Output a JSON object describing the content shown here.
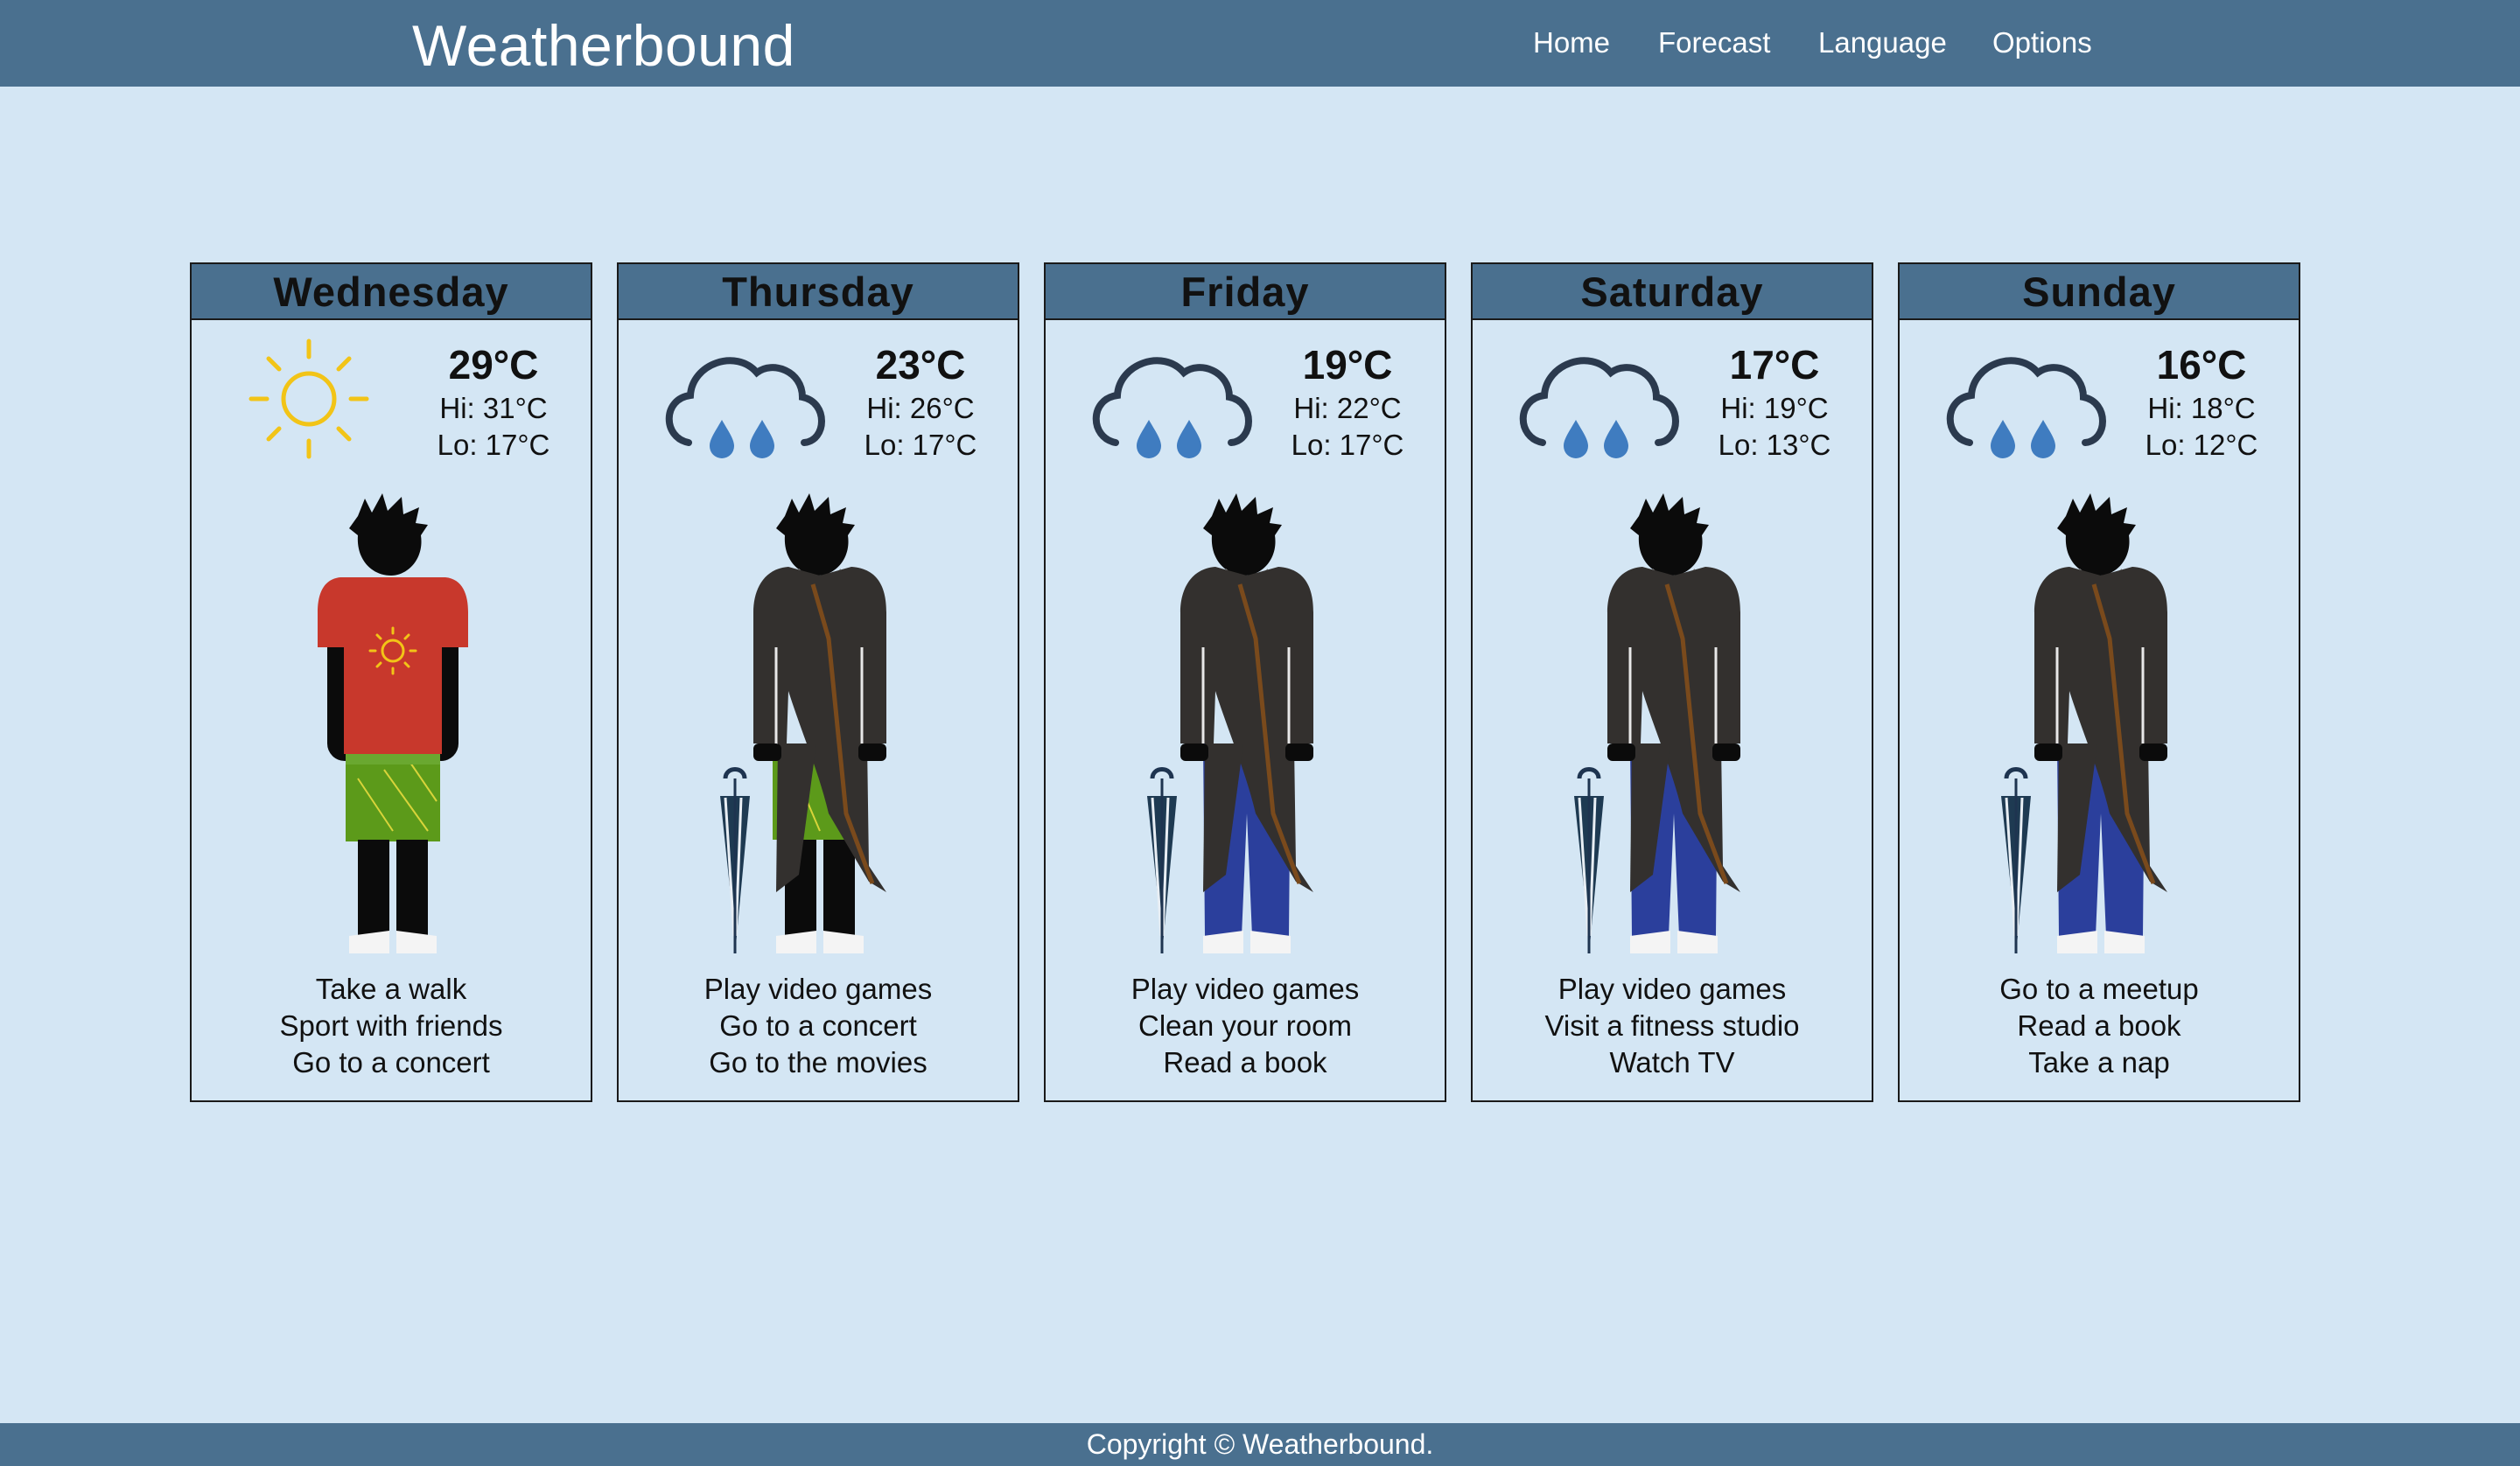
{
  "brand": "Weatherbound",
  "nav": [
    "Home",
    "Forecast",
    "Language",
    "Options"
  ],
  "days": [
    {
      "name": "Wednesday",
      "temp": "29°C",
      "hi": "Hi: 31°C",
      "lo": "Lo: 17°C",
      "icon": "sun-icon",
      "outfit": "t-shirt-shorts",
      "activities": [
        "Take a walk",
        "Sport with friends",
        "Go to a concert"
      ]
    },
    {
      "name": "Thursday",
      "temp": "23°C",
      "hi": "Hi: 26°C",
      "lo": "Lo: 17°C",
      "icon": "rain-cloud-icon",
      "outfit": "coat-shorts-umbrella",
      "activities": [
        "Play video games",
        "Go to a concert",
        "Go to the movies"
      ]
    },
    {
      "name": "Friday",
      "temp": "19°C",
      "hi": "Hi: 22°C",
      "lo": "Lo: 17°C",
      "icon": "rain-cloud-icon",
      "outfit": "coat-jeans-umbrella",
      "activities": [
        "Play video games",
        "Clean your room",
        "Read a book"
      ]
    },
    {
      "name": "Saturday",
      "temp": "17°C",
      "hi": "Hi: 19°C",
      "lo": "Lo: 13°C",
      "icon": "rain-cloud-icon",
      "outfit": "coat-jeans-umbrella",
      "activities": [
        "Play video games",
        "Visit a fitness studio",
        "Watch TV"
      ]
    },
    {
      "name": "Sunday",
      "temp": "16°C",
      "hi": "Hi: 18°C",
      "lo": "Lo: 12°C",
      "icon": "rain-cloud-icon",
      "outfit": "coat-jeans-umbrella",
      "activities": [
        "Go to a meetup",
        "Read a book",
        "Take a nap"
      ]
    }
  ],
  "footer": "Copyright © Weatherbound.",
  "colors": {
    "header": "#4a708f",
    "background": "#d4e6f4",
    "sun": "#f2c417",
    "cloud": "#2b3a4e",
    "drop": "#3f7cc0",
    "tshirt": "#c8382c",
    "shorts": "#5c9a1a",
    "coat": "#33302e",
    "jeans": "#2b3f9c"
  }
}
